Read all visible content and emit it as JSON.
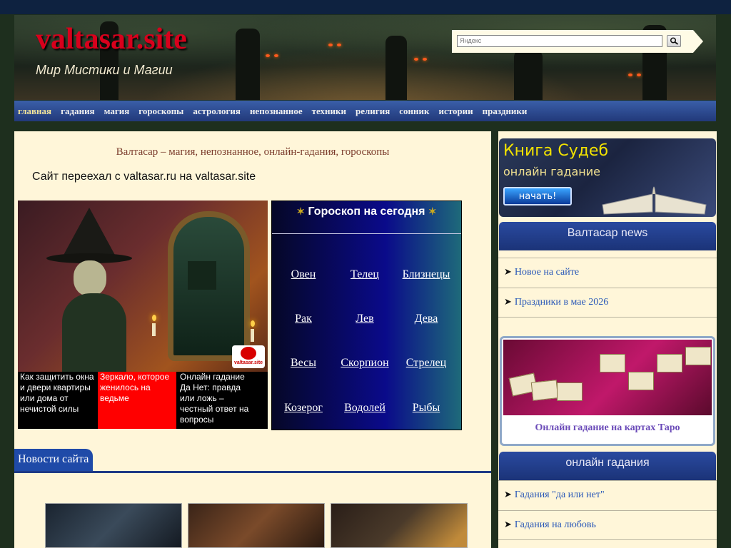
{
  "header": {
    "logo": "valtasar.site",
    "tagline": "Мир Мистики и Магии",
    "search_placeholder": "Яндекс"
  },
  "nav": {
    "items": [
      "главная",
      "гадания",
      "магия",
      "гороскопы",
      "астрология",
      "непознанное",
      "техники",
      "религия",
      "сонник",
      "истории",
      "праздники"
    ]
  },
  "main": {
    "title": "Валтасар – магия, непознанное, онлайн-гадания, гороскопы",
    "moved_notice": "Сайт переехал с valtasar.ru на valtasar.site",
    "slider": {
      "logo_text": "valtasar.site",
      "captions": [
        "Как защитить окна и двери квартиры или дома от нечистой силы",
        "Зеркало, которое женилось на ведьме",
        "Онлайн гадание Да Нет: правда или ложь – честный ответ на вопросы"
      ]
    },
    "horoscope": {
      "title": "Гороскоп на сегодня",
      "star": "✶",
      "signs": [
        "Овен",
        "Телец",
        "Близнецы",
        "Рак",
        "Лев",
        "Дева",
        "Весы",
        "Скорпион",
        "Стрелец",
        "Козерог",
        "Водолей",
        "Рыбы"
      ]
    },
    "news_tab": "Новости сайта"
  },
  "sidebar": {
    "kniga": {
      "title": "Книга Судеб",
      "subtitle": "онлайн гадание",
      "button": "начать!"
    },
    "news": {
      "header": "Валтасар news",
      "items": [
        "Новое на сайте",
        "Праздники в мае 2026"
      ]
    },
    "tarot_caption": "Онлайн гадание на картах Таро",
    "online": {
      "header": "онлайн гадания",
      "items": [
        "Гадания \"да или нет\"",
        "Гадания на любовь"
      ]
    },
    "arrow": "➤"
  },
  "colors": {
    "logo": "#d8001c",
    "nav_bg": "#22397a",
    "content_bg": "#fff6d9",
    "link": "#2a58b8",
    "caption_red": "#ff0000"
  }
}
